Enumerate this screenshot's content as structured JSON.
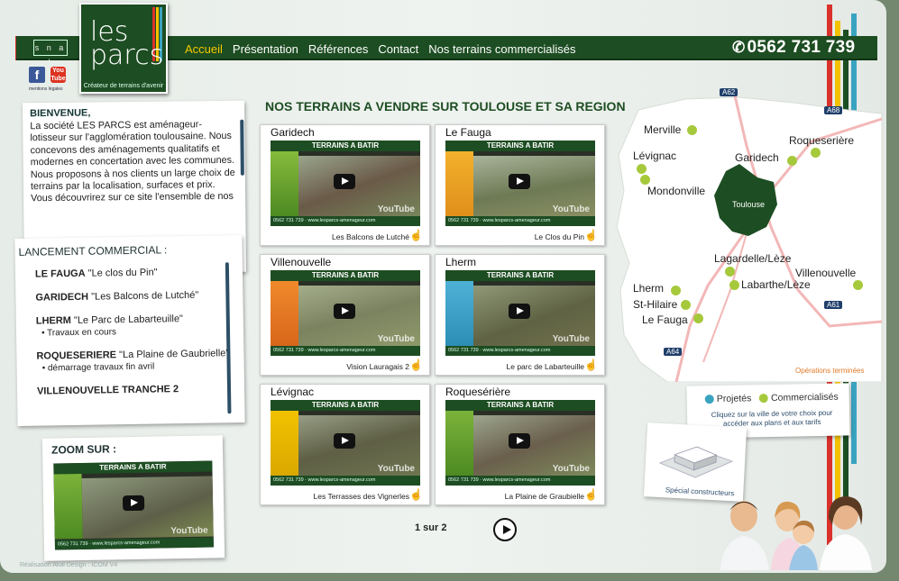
{
  "header": {
    "snal": "s n a l",
    "facebook_letter": "f",
    "youtube_label": "You Tube",
    "mentions": "mentions légales",
    "logo_text": "les parcs",
    "logo_tagline": "Créateur de terrains d'avenir",
    "nav": [
      "Accueil",
      "Présentation",
      "Références",
      "Contact",
      "Nos terrains commercialisés"
    ],
    "active_nav": "Accueil",
    "phone": "0562 731 739"
  },
  "welcome": {
    "title": "BIENVENUE,",
    "text": "La société LES PARCS est aménageur-lotisseur sur l'agglomération toulousaine. Nous concevons des aménagements qualitatifs et modernes en concertation avec les communes. Nous proposons à nos clients un large choix de terrains par la localisation, surfaces et prix. Vous découvrirez sur ce site l'ensemble de nos"
  },
  "launch": {
    "title": "LANCEMENT COMMERCIAL :",
    "items": [
      {
        "place": "LE FAUGA",
        "name": "\"Le clos du Pin\"",
        "sub": ""
      },
      {
        "place": "GARIDECH",
        "name": "\"Les Balcons de Lutché\"",
        "sub": ""
      },
      {
        "place": "LHERM",
        "name": "\"Le Parc de Labarteuille\"",
        "sub": "• Travaux en cours"
      },
      {
        "place": "ROQUESERIERE",
        "name": "\"La Plaine de Gaubrielle\"",
        "sub": "• démarrage travaux fin avril"
      },
      {
        "place": "VILLENOUVELLE TRANCHE 2",
        "name": "",
        "sub": ""
      }
    ]
  },
  "zoom": {
    "title": "ZOOM SUR :"
  },
  "credit": "Réalisation Akal Design : ICOM V4",
  "section_title": "NOS TERRAINS A VENDRE SUR TOULOUSE ET SA REGION",
  "thumb": {
    "header": "TERRAINS A BATIR",
    "footer": "0562 731 739 · www.lesparcs-amenageur.com",
    "yt": "YouTube"
  },
  "tiles": [
    {
      "name": "Garidech",
      "caption": "Les Balcons de Lutché"
    },
    {
      "name": "Le Fauga",
      "caption": "Le Clos du Pin"
    },
    {
      "name": "Villenouvelle",
      "caption": "Vision Lauragais 2"
    },
    {
      "name": "Lherm",
      "caption": "Le parc de Labarteuille"
    },
    {
      "name": "Lévignac",
      "caption": "Les Terrasses des Vignerles"
    },
    {
      "name": "Roquesérière",
      "caption": "La Plaine de Graubielle"
    }
  ],
  "pager": "1 sur 2",
  "map": {
    "center": "Toulouse",
    "cities": [
      "Merville",
      "Roqueserière",
      "Garidech",
      "Lévignac",
      "Mondonville",
      "Lagardelle/Lèze",
      "Villenouvelle",
      "Labarthe/Lèze",
      "Lherm",
      "St-Hilaire",
      "Le Fauga"
    ],
    "roads": [
      "A62",
      "A68",
      "A61",
      "A64"
    ],
    "ops": "Opérations terminées"
  },
  "legend": {
    "projected": "Projetés",
    "commercialized": "Commercialisés",
    "note": "Cliquez sur la ville de votre choix pour accéder aux plans et aux tarifs",
    "colors": {
      "projected": "#3aa3c0",
      "commercialized": "#a6c93c"
    }
  },
  "special": "Spécial constructeurs"
}
